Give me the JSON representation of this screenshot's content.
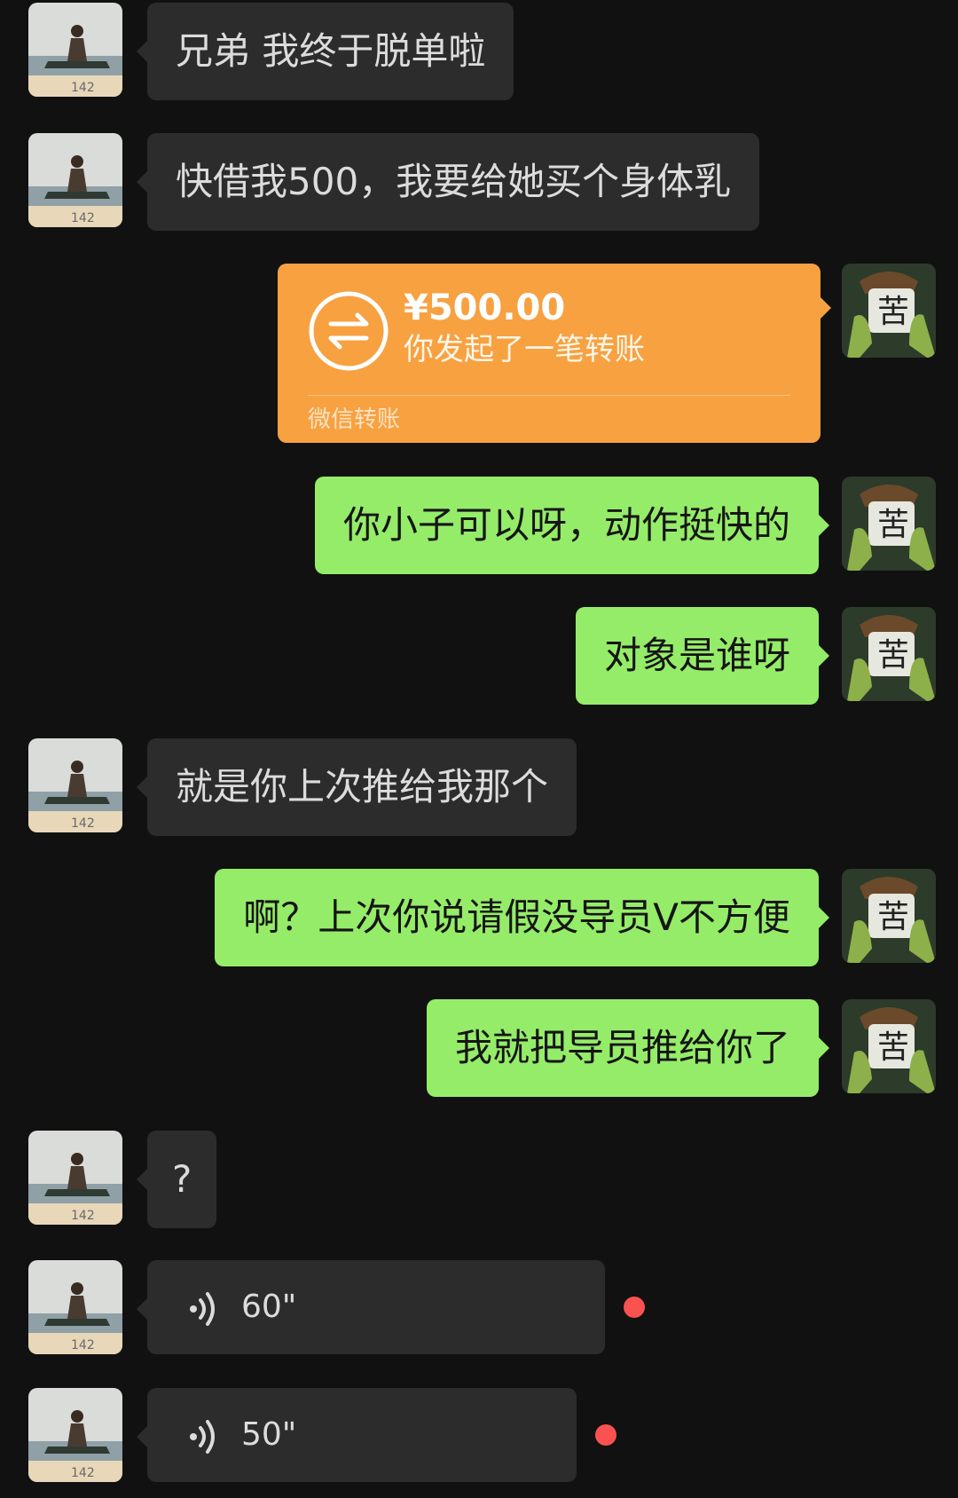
{
  "messages": [
    {
      "side": "in",
      "text": "兄弟 我终于脱单啦"
    },
    {
      "side": "in",
      "text": "快借我500，我要给她买个身体乳"
    },
    {
      "side": "out",
      "type": "transfer",
      "amount": "¥500.00",
      "desc": "你发起了一笔转账",
      "footer": "微信转账"
    },
    {
      "side": "out",
      "text": "你小子可以呀，动作挺快的"
    },
    {
      "side": "out",
      "text": "对象是谁呀"
    },
    {
      "side": "in",
      "text": "就是你上次推给我那个"
    },
    {
      "side": "out",
      "text": "啊？上次你说请假没导员V不方便"
    },
    {
      "side": "out",
      "text": "我就把导员推给你了"
    },
    {
      "side": "in",
      "text": "?"
    },
    {
      "side": "in",
      "type": "voice",
      "duration": "60\""
    },
    {
      "side": "in",
      "type": "voice",
      "duration": "50\""
    }
  ],
  "avatars": {
    "friend_label": "142"
  },
  "colors": {
    "background": "#111111",
    "incoming_bubble": "#2c2c2c",
    "outgoing_bubble": "#95ec69",
    "transfer_card": "#f7a141",
    "unread_dot": "#fa5151"
  }
}
